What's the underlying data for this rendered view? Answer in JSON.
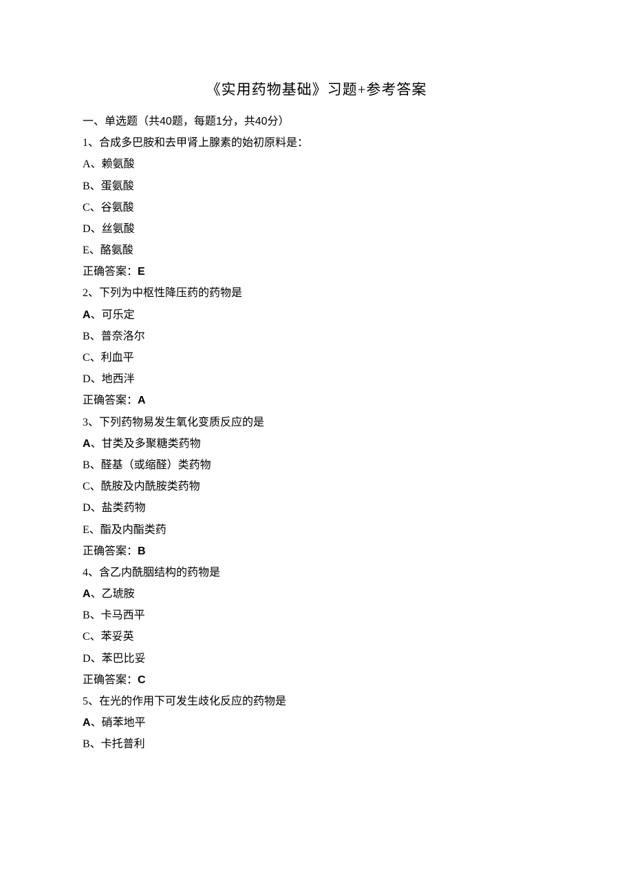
{
  "title": "《实用药物基础》习题+参考答案",
  "section": {
    "prefix": "一、单选题（共",
    "count1_a": "40",
    "mid1": "题，每题",
    "count1_b": "1",
    "mid2": "分，共",
    "count1_c": "40",
    "suffix": "分）"
  },
  "answer_label": "正确答案：",
  "questions": [
    {
      "num": "1",
      "stem": "、合成多巴胺和去甲肾上腺素的始初原料是：",
      "opts": [
        {
          "letter": "A",
          "text": "、赖氨酸",
          "bold": false
        },
        {
          "letter": "B",
          "text": "、蛋氨酸",
          "bold": false
        },
        {
          "letter": "C",
          "text": "、谷氨酸",
          "bold": false
        },
        {
          "letter": "D",
          "text": "、丝氨酸",
          "bold": false
        },
        {
          "letter": "E",
          "text": "、酪氨酸",
          "bold": false
        }
      ],
      "answer": "E"
    },
    {
      "num": "2",
      "stem": "、下列为中枢性降压药的药物是",
      "opts": [
        {
          "letter": "A",
          "text": "、可乐定",
          "bold": true
        },
        {
          "letter": "B",
          "text": "、普奈洛尔",
          "bold": false
        },
        {
          "letter": "C",
          "text": "、利血平",
          "bold": false
        },
        {
          "letter": "D",
          "text": "、地西泮",
          "bold": false
        }
      ],
      "answer": "A"
    },
    {
      "num": "3",
      "stem": "、下列药物易发生氧化变质反应的是",
      "opts": [
        {
          "letter": "A",
          "text": "、甘类及多聚糖类药物",
          "bold": true
        },
        {
          "letter": "B",
          "text": "、醛基（或缩醛）类药物",
          "bold": false
        },
        {
          "letter": "C",
          "text": "、酰胺及内酰胺类药物",
          "bold": false
        },
        {
          "letter": "D",
          "text": "、盐类药物",
          "bold": false
        },
        {
          "letter": "E",
          "text": "、酯及内酯类药",
          "bold": false
        }
      ],
      "answer": "B"
    },
    {
      "num": "4",
      "stem": "、含乙内酰胭结构的药物是",
      "opts": [
        {
          "letter": "A",
          "text": "、乙琥胺",
          "bold": true
        },
        {
          "letter": "B",
          "text": "、卡马西平",
          "bold": false
        },
        {
          "letter": "C",
          "text": "、苯妥英",
          "bold": false
        },
        {
          "letter": "D",
          "text": "、苯巴比妥",
          "bold": false
        }
      ],
      "answer": "C"
    },
    {
      "num": "5",
      "stem": "、在光的作用下可发生歧化反应的药物是",
      "opts": [
        {
          "letter": "A",
          "text": "、硝苯地平",
          "bold": true
        },
        {
          "letter": "B",
          "text": "、卡托普利",
          "bold": false
        }
      ],
      "answer": null
    }
  ]
}
